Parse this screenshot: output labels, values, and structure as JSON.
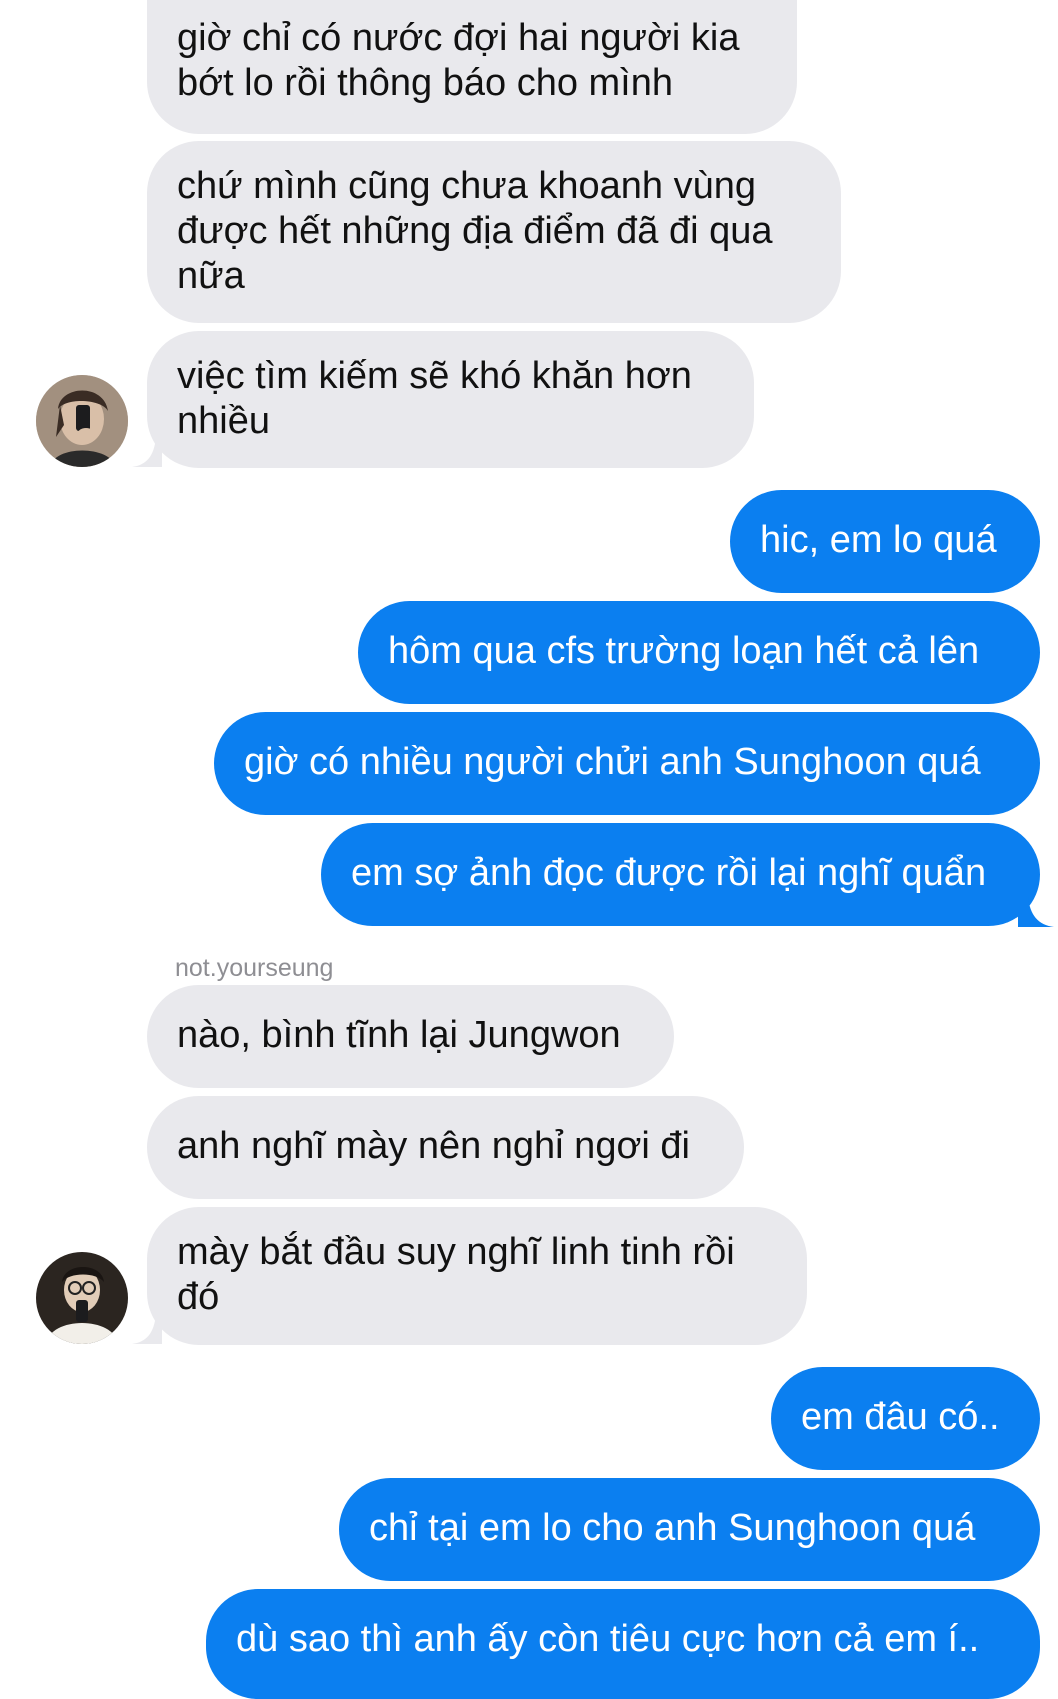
{
  "conversation": {
    "sender_name": "not.yourseung",
    "messages": [
      {
        "id": "m1",
        "from": "them",
        "text": "giờ chỉ có nước đợi hai người kia\nbớt lo rồi thông báo cho mình"
      },
      {
        "id": "m2",
        "from": "them",
        "text": "chứ mình cũng chưa khoanh vùng\nđược hết những địa điểm đã đi qua\nnữa"
      },
      {
        "id": "m3",
        "from": "them",
        "text": "việc tìm kiếm sẽ khó khăn hơn\nnhiều"
      },
      {
        "id": "m4",
        "from": "me",
        "text": "hic, em lo quá"
      },
      {
        "id": "m5",
        "from": "me",
        "text": "hôm qua cfs trường loạn hết cả lên"
      },
      {
        "id": "m6",
        "from": "me",
        "text": "giờ có nhiều người chửi anh Sunghoon quá"
      },
      {
        "id": "m7",
        "from": "me",
        "text": "em sợ ảnh đọc được rồi lại nghĩ quẩn"
      },
      {
        "id": "m8",
        "from": "them",
        "text": "nào, bình tĩnh lại Jungwon"
      },
      {
        "id": "m9",
        "from": "them",
        "text": "anh nghĩ mày nên nghỉ ngơi đi"
      },
      {
        "id": "m10",
        "from": "them",
        "text": "mày bắt đầu suy nghĩ linh tinh rồi\nđó"
      },
      {
        "id": "m11",
        "from": "me",
        "text": "em đâu có.."
      },
      {
        "id": "m12",
        "from": "me",
        "text": "chỉ tại em lo cho anh Sunghoon quá"
      },
      {
        "id": "m13",
        "from": "me",
        "text": "dù sao thì anh ấy còn tiêu cực hơn cả em í.."
      }
    ]
  },
  "colors": {
    "incoming_bubble": "#e9e9ed",
    "outgoing_bubble": "#0b7ff0",
    "incoming_text": "#111111",
    "outgoing_text": "#ffffff",
    "sender_name": "#8e8e93"
  },
  "icons": {
    "avatar_1": "avatar-mirror-selfie-icon",
    "avatar_2": "avatar-mirror-selfie-glasses-icon"
  }
}
